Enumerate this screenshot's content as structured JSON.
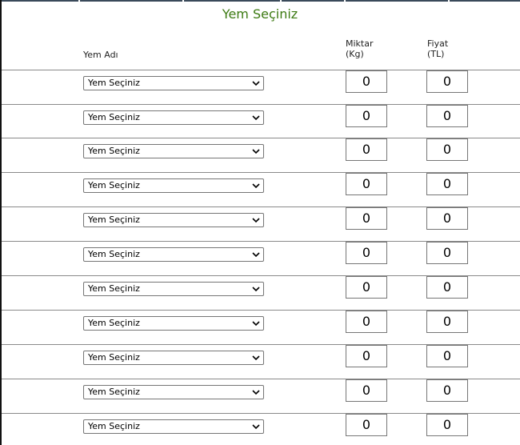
{
  "title": "Yem Seçiniz",
  "headers": {
    "name": "Yem Adı",
    "qty_line1": "Miktar",
    "qty_line2": "(Kg)",
    "price_line1": "Fiyat",
    "price_line2": "(TL)"
  },
  "rows": [
    {
      "feed": "Yem Seçiniz",
      "qty": "0",
      "price": "0"
    },
    {
      "feed": "Yem Seçiniz",
      "qty": "0",
      "price": "0"
    },
    {
      "feed": "Yem Seçiniz",
      "qty": "0",
      "price": "0"
    },
    {
      "feed": "Yem Seçiniz",
      "qty": "0",
      "price": "0"
    },
    {
      "feed": "Yem Seçiniz",
      "qty": "0",
      "price": "0"
    },
    {
      "feed": "Yem Seçiniz",
      "qty": "0",
      "price": "0"
    },
    {
      "feed": "Yem Seçiniz",
      "qty": "0",
      "price": "0"
    },
    {
      "feed": "Yem Seçiniz",
      "qty": "0",
      "price": "0"
    },
    {
      "feed": "Yem Seçiniz",
      "qty": "0",
      "price": "0"
    },
    {
      "feed": "Yem Seçiniz",
      "qty": "0",
      "price": "0"
    },
    {
      "feed": "Yem Seçiniz",
      "qty": "0",
      "price": "0"
    }
  ],
  "colors": {
    "title": "#3c7a12",
    "border": "#767676"
  }
}
